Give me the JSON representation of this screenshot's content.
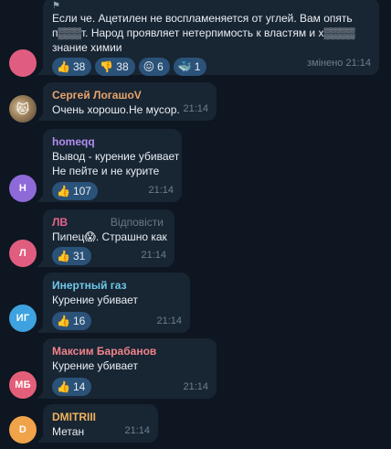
{
  "messages": [
    {
      "text_lines": [
        "Если че. Ацетилен не воспламеняется от углей. Вам опять",
        "п▒▒▒т. Народ проявляет нетерпимость к властям и х▒▒▒▒",
        "знание химии"
      ],
      "reactions": [
        {
          "emoji_icon": "thumbs-up-icon",
          "glyph": "👍",
          "count": "38"
        },
        {
          "emoji_icon": "thumbs-down-icon",
          "glyph": "👎",
          "count": "38"
        },
        {
          "emoji_icon": "grimace-face-icon",
          "glyph": "😖",
          "count": "6"
        },
        {
          "emoji_icon": "whale-icon",
          "glyph": "🐳",
          "count": "1"
        }
      ],
      "time": "змінено 21:14",
      "avatar_color": "#e05d80"
    },
    {
      "sender": "Сергей ЛогашоV",
      "sender_color": "#e8a46b",
      "text": "Очень хорошо.Не мусор.",
      "time": "21:14",
      "avatar_icon": "cat-photo-avatar"
    },
    {
      "sender": "homeqq",
      "sender_color": "#b38df0",
      "text_lines": [
        "Вывод - курение убивает",
        "Не пейте и не курите"
      ],
      "reactions": [
        {
          "emoji_icon": "thumbs-up-icon",
          "glyph": "👍",
          "count": "107"
        }
      ],
      "time": "21:14",
      "avatar_initials": "H",
      "avatar_color": "#8e6ad9"
    },
    {
      "sender": "ЛВ",
      "sender_color": "#e6648c",
      "reply_label": "Відповісти",
      "text": "Пипец",
      "text_suffix": ". Страшно как",
      "inline_emoji_icon": "scared-face-icon",
      "inline_emoji": "😱",
      "reactions": [
        {
          "emoji_icon": "thumbs-up-icon",
          "glyph": "👍",
          "count": "31"
        }
      ],
      "time": "21:14",
      "avatar_initials": "Л",
      "avatar_color": "#e05d80"
    },
    {
      "sender": "Инертный газ",
      "sender_color": "#6ec7e8",
      "text": "Курение убивает",
      "reactions": [
        {
          "emoji_icon": "thumbs-up-icon",
          "glyph": "👍",
          "count": "16"
        }
      ],
      "time": "21:14",
      "avatar_initials": "ИГ",
      "avatar_color": "#3ea2e0"
    },
    {
      "sender": "Максим Барабанов",
      "sender_color": "#f0838a",
      "text": "Курение убивает",
      "reactions": [
        {
          "emoji_icon": "thumbs-up-icon",
          "glyph": "👍",
          "count": "14"
        }
      ],
      "time": "21:14",
      "avatar_initials": "МБ",
      "avatar_color": "#e35f79"
    },
    {
      "sender": "DMITRIII",
      "sender_color": "#f0b35d",
      "text": "Метан",
      "time": "21:14",
      "avatar_initials": "D",
      "avatar_color": "#f0a349"
    }
  ]
}
